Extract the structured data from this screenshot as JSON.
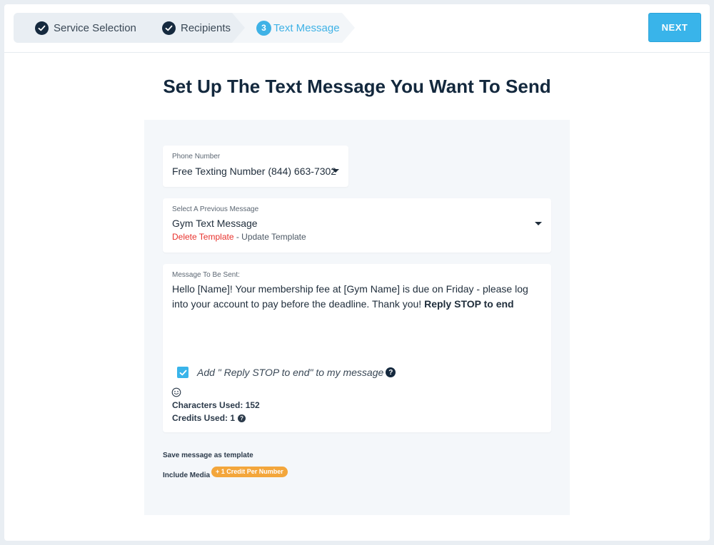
{
  "steps": [
    {
      "label": "Service Selection",
      "state": "done"
    },
    {
      "label": "Recipients",
      "state": "done"
    },
    {
      "label": "Text Message",
      "state": "active",
      "number": "3"
    }
  ],
  "header": {
    "next_label": "NEXT"
  },
  "page_title": "Set Up The Text Message You Want To Send",
  "phone": {
    "label": "Phone Number",
    "value": "Free Texting Number (844) 663-7302"
  },
  "previous_message": {
    "label": "Select A Previous Message",
    "value": "Gym Text Message",
    "delete_label": "Delete Template",
    "separator": " - ",
    "update_label": "Update Template"
  },
  "message": {
    "label": "Message To Be Sent:",
    "body": "Hello [Name]! Your membership fee at [Gym Name] is due on Friday - please log into your account to pay before the deadline. Thank you! ",
    "body_suffix": "Reply STOP to end",
    "reply_stop_option": "Add \" Reply STOP to end\" to my message",
    "reply_stop_checked": true,
    "characters_used": "Characters Used: 152",
    "credits_used": "Credits Used: 1"
  },
  "options": {
    "save_template": "Save message as template",
    "include_media": "Include Media",
    "media_badge": "+ 1 Credit Per Number"
  },
  "colors": {
    "accent": "#39b4ea",
    "dark": "#15293e",
    "danger": "#e8312c",
    "badge": "#f3a63b"
  },
  "icons": [
    "check-icon",
    "check-icon",
    "caret-down-icon",
    "caret-down-icon",
    "checkbox-check-icon",
    "question-icon",
    "emoji-icon",
    "question-icon"
  ]
}
